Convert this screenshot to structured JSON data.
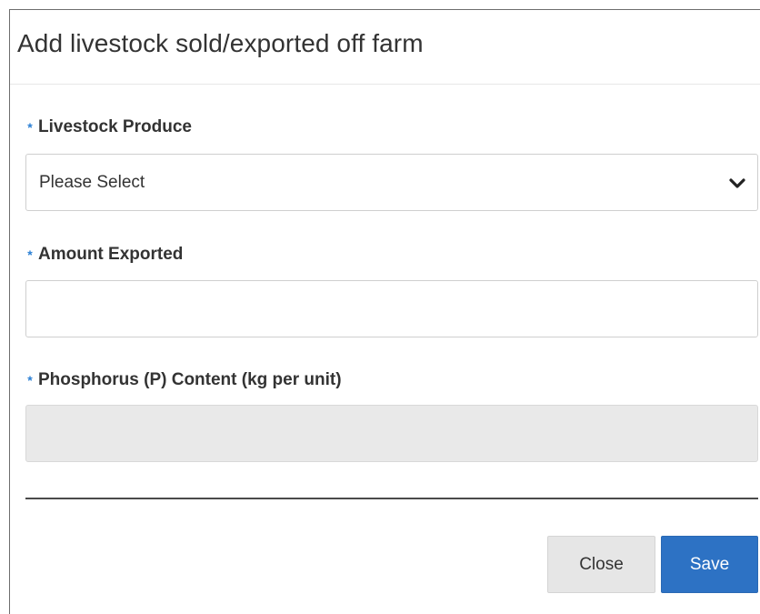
{
  "dialog": {
    "title": "Add livestock sold/exported off farm"
  },
  "fields": {
    "livestock_produce": {
      "label": "Livestock Produce",
      "required_marker": "*",
      "selected_value": "Please Select"
    },
    "amount_exported": {
      "label": "Amount Exported",
      "required_marker": "*",
      "value": ""
    },
    "phosphorus_content": {
      "label": "Phosphorus (P) Content (kg per unit)",
      "required_marker": "*",
      "value": ""
    }
  },
  "footer": {
    "close_label": "Close",
    "save_label": "Save"
  },
  "colors": {
    "required_marker": "#2a7fd4",
    "save_button": "#2d72c4",
    "close_button": "#e6e6e6",
    "readonly_field": "#e9e9e9"
  },
  "icons": {
    "dropdown": "chevron-down-icon",
    "required": "asterisk-icon"
  }
}
